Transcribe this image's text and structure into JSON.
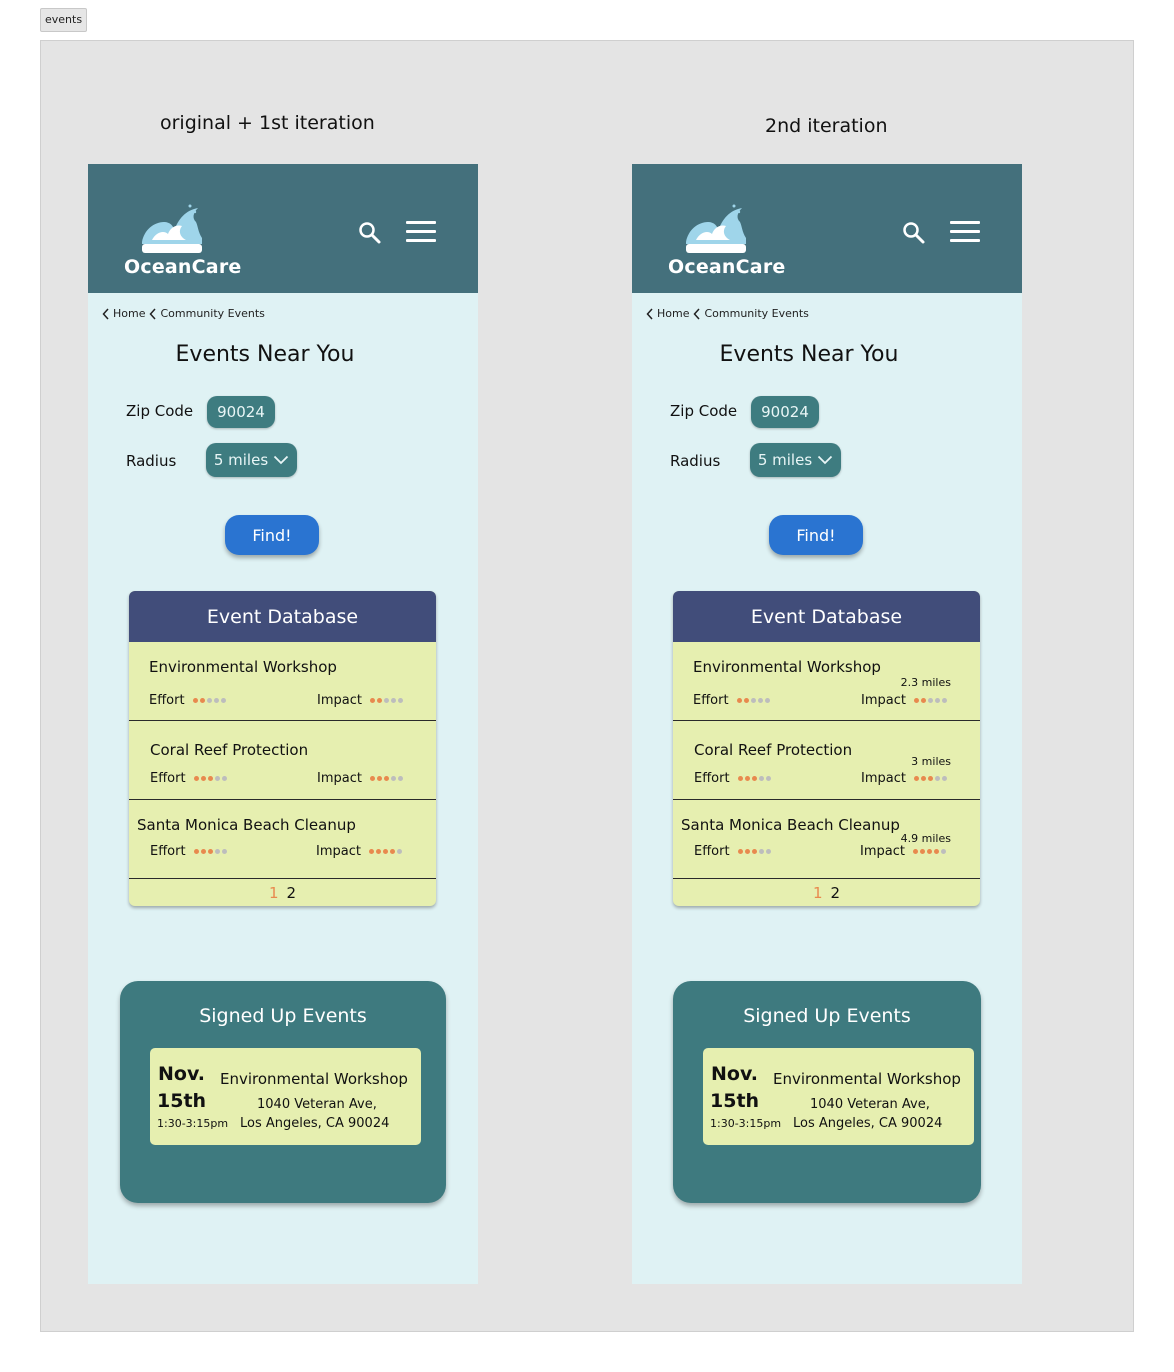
{
  "frame_tag": "events",
  "columns": [
    {
      "title": "original + 1st iteration",
      "app": {
        "brand": "OceanCare",
        "breadcrumb": [
          "Home",
          "Community Events"
        ],
        "heading": "Events Near You",
        "zip_label": "Zip Code",
        "zip_value": "90024",
        "radius_label": "Radius",
        "radius_value": "5 miles",
        "find_label": "Find!",
        "database_title": "Event Database",
        "events": [
          {
            "name": "Environmental Workshop",
            "distance": "",
            "effort_label": "Effort",
            "effort": 2,
            "impact_label": "Impact",
            "impact": 2
          },
          {
            "name": "Coral Reef Protection",
            "distance": "",
            "effort_label": "Effort",
            "effort": 3,
            "impact_label": "Impact",
            "impact": 3
          },
          {
            "name": "Santa Monica Beach Cleanup",
            "distance": "",
            "effort_label": "Effort",
            "effort": 3,
            "impact_label": "Impact",
            "impact": 4
          }
        ],
        "pages": [
          "1",
          "2"
        ],
        "signed_title": "Signed Up Events",
        "signed_event": {
          "month": "Nov.",
          "day": "15th",
          "time": "1:30-3:15pm",
          "name": "Environmental Workshop",
          "address_line1": "1040 Veteran Ave,",
          "address_line2": "Los Angeles, CA 90024"
        }
      }
    },
    {
      "title": "2nd iteration",
      "app": {
        "brand": "OceanCare",
        "breadcrumb": [
          "Home",
          "Community Events"
        ],
        "heading": "Events Near You",
        "zip_label": "Zip Code",
        "zip_value": "90024",
        "radius_label": "Radius",
        "radius_value": "5 miles",
        "find_label": "Find!",
        "database_title": "Event Database",
        "events": [
          {
            "name": "Environmental Workshop",
            "distance": "2.3 miles",
            "effort_label": "Effort",
            "effort": 2,
            "impact_label": "Impact",
            "impact": 2
          },
          {
            "name": "Coral Reef Protection",
            "distance": "3 miles",
            "effort_label": "Effort",
            "effort": 3,
            "impact_label": "Impact",
            "impact": 3
          },
          {
            "name": "Santa Monica Beach Cleanup",
            "distance": "4.9 miles",
            "effort_label": "Effort",
            "effort": 3,
            "impact_label": "Impact",
            "impact": 4
          }
        ],
        "pages": [
          "1",
          "2"
        ],
        "signed_title": "Signed Up Events",
        "signed_event": {
          "month": "Nov.",
          "day": "15th",
          "time": "1:30-3:15pm",
          "name": "Environmental Workshop",
          "address_line1": "1040 Veteran Ave,",
          "address_line2": "Los Angeles, CA 90024"
        }
      }
    }
  ],
  "rating_max": 5,
  "colors": {
    "header": "#44707c",
    "page_bg": "#dff2f4",
    "pill": "#3e7c80",
    "find_button": "#2a74d1",
    "database_header": "#414d7a",
    "card_bg": "#e6efb0",
    "dot_on": "#e8894e",
    "dot_off": "#bdbdbd"
  },
  "icons": [
    "wave-logo-icon",
    "search-icon",
    "hamburger-menu-icon",
    "chevron-left-icon",
    "chevron-down-icon"
  ]
}
